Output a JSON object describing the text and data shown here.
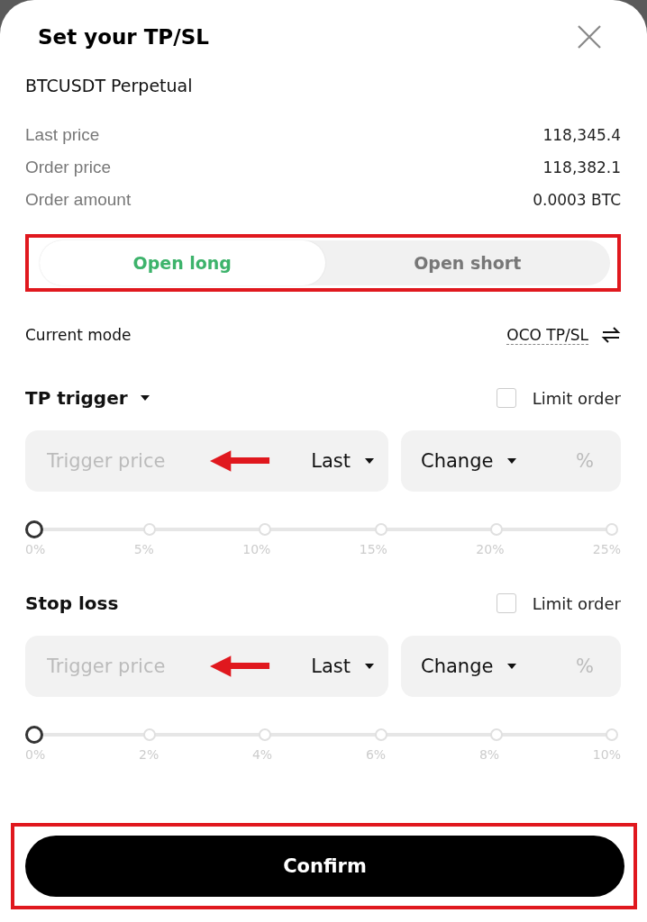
{
  "title": "Set your TP/SL",
  "instrument": "BTCUSDT Perpetual",
  "details": [
    {
      "label": "Last price",
      "value": "118,345.4"
    },
    {
      "label": "Order price",
      "value": "118,382.1"
    },
    {
      "label": "Order amount",
      "value": "0.0003 BTC"
    }
  ],
  "sides": [
    {
      "label": "Open long",
      "selected": true
    },
    {
      "label": "Open short",
      "selected": false
    }
  ],
  "mode": {
    "label": "Current mode",
    "value": "OCO TP/SL"
  },
  "sections": [
    {
      "title": "TP trigger",
      "title_dropdown": true,
      "limit_order": {
        "label": "Limit order",
        "checked": false
      },
      "trigger": {
        "placeholder": "Trigger price",
        "price_type": "Last"
      },
      "change": {
        "label": "Change",
        "unit": "%"
      },
      "slider": {
        "level": 0,
        "ticks": [
          "0%",
          "5%",
          "10%",
          "15%",
          "20%",
          "25%"
        ]
      }
    },
    {
      "title": "Stop loss",
      "title_dropdown": false,
      "limit_order": {
        "label": "Limit order",
        "checked": false
      },
      "trigger": {
        "placeholder": "Trigger price",
        "price_type": "Last"
      },
      "change": {
        "label": "Change",
        "unit": "%"
      },
      "slider": {
        "level": 0,
        "ticks": [
          "0%",
          "2%",
          "4%",
          "6%",
          "8%",
          "10%"
        ]
      }
    }
  ],
  "confirm": "Confirm"
}
